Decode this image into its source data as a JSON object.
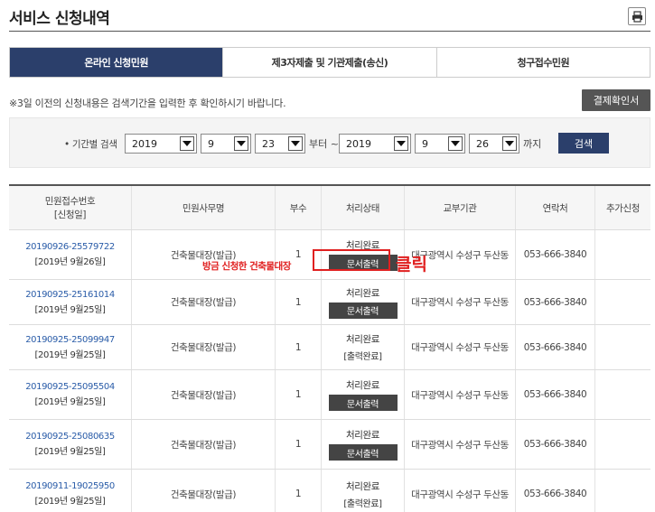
{
  "page": {
    "title": "서비스 신청내역",
    "print_icon": "printer-icon"
  },
  "tabs": [
    {
      "label": "온라인 신청민원",
      "active": true
    },
    {
      "label": "제3자제출 및 기관제출(송신)",
      "active": false
    },
    {
      "label": "청구접수민원",
      "active": false
    }
  ],
  "notice": "※3일 이전의 신청내용은 검색기간을 입력한 후 확인하시기 바랍니다.",
  "receipt_button": "결제확인서",
  "search": {
    "label": "• 기간별 검색",
    "from_year": "2019",
    "from_month": "9",
    "from_day": "23",
    "from_suffix": "부터 ~",
    "to_year": "2019",
    "to_month": "9",
    "to_day": "26",
    "to_suffix": "까지",
    "button": "검색"
  },
  "table": {
    "headers": {
      "receipt_no": "민원접수번호",
      "receipt_no_sub": "[신청일]",
      "service": "민원사무명",
      "copies": "부수",
      "status": "처리상태",
      "agency": "교부기관",
      "contact": "연락처",
      "extra": "추가신청"
    },
    "rows": [
      {
        "no": "20190926-25579722",
        "date": "[2019년 9월26일]",
        "service": "건축물대장(발급)",
        "copies": "1",
        "status": "처리완료",
        "action": "문서출력",
        "agency": "대구광역시 수성구 두산동",
        "contact": "053-666-3840"
      },
      {
        "no": "20190925-25161014",
        "date": "[2019년 9월25일]",
        "service": "건축물대장(발급)",
        "copies": "1",
        "status": "처리완료",
        "action": "문서출력",
        "agency": "대구광역시 수성구 두산동",
        "contact": "053-666-3840"
      },
      {
        "no": "20190925-25099947",
        "date": "[2019년 9월25일]",
        "service": "건축물대장(발급)",
        "copies": "1",
        "status": "처리완료",
        "action": "[출력완료]",
        "agency": "대구광역시 수성구 두산동",
        "contact": "053-666-3840"
      },
      {
        "no": "20190925-25095504",
        "date": "[2019년 9월25일]",
        "service": "건축물대장(발급)",
        "copies": "1",
        "status": "처리완료",
        "action": "문서출력",
        "agency": "대구광역시 수성구 두산동",
        "contact": "053-666-3840"
      },
      {
        "no": "20190925-25080635",
        "date": "[2019년 9월25일]",
        "service": "건축물대장(발급)",
        "copies": "1",
        "status": "처리완료",
        "action": "문서출력",
        "agency": "대구광역시 수성구 두산동",
        "contact": "053-666-3840"
      },
      {
        "no": "20190911-19025950",
        "date": "[2019년 9월25일]",
        "service": "건축물대장(발급)",
        "copies": "1",
        "status": "처리완료",
        "action": "[출력완료]",
        "agency": "대구광역시 수성구 두산동",
        "contact": "053-666-3840"
      }
    ]
  },
  "annotation": {
    "text": "방금 신청한 건축물대장",
    "click": "클릭",
    "color": "#e02020"
  }
}
